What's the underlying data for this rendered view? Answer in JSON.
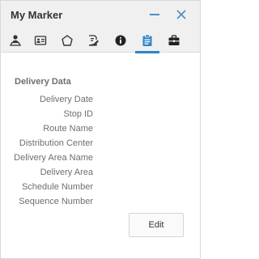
{
  "window": {
    "title": "My Marker"
  },
  "tabs": [
    {
      "icon": "person-pin-icon",
      "active": false
    },
    {
      "icon": "id-card-icon",
      "active": false
    },
    {
      "icon": "pentagon-icon",
      "active": false
    },
    {
      "icon": "edit-document-icon",
      "active": false
    },
    {
      "icon": "info-icon",
      "active": false
    },
    {
      "icon": "clipboard-icon",
      "active": true
    },
    {
      "icon": "briefcase-icon",
      "active": false
    }
  ],
  "section": {
    "title": "Delivery Data",
    "fields": [
      "Delivery Date",
      "Stop ID",
      "Route Name",
      "Distribution Center",
      "Delivery Area Name",
      "Delivery Area",
      "Schedule Number",
      "Sequence Number"
    ]
  },
  "actions": {
    "edit_label": "Edit"
  },
  "colors": {
    "accent": "#2d84c9",
    "icon": "#333333",
    "label": "#6e6e6e"
  }
}
